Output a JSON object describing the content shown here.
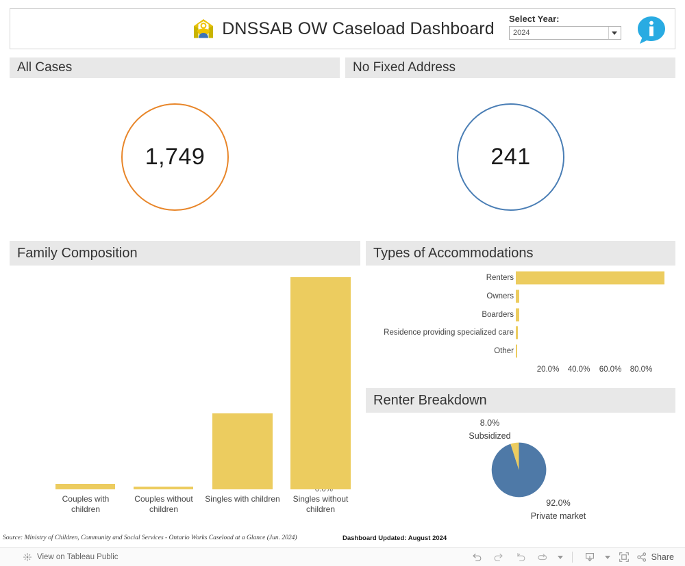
{
  "header": {
    "title": "DNSSAB OW Caseload Dashboard",
    "logo_icon": "dnssab-house-logo",
    "year_filter_label": "Select Year:",
    "year_selected": "2024",
    "year_options": [
      "2024"
    ],
    "info_icon": "info-speech-bubble-icon"
  },
  "panels": {
    "all_cases": {
      "title": "All Cases",
      "value": "1,749",
      "ring_color": "#E8862A"
    },
    "no_fixed_address": {
      "title": "No Fixed Address",
      "value": "241",
      "ring_color": "#4A7EB5"
    },
    "family_composition": {
      "title": "Family Composition"
    },
    "types_of_accommodations": {
      "title": "Types of Accommodations"
    },
    "renter_breakdown": {
      "title": "Renter Breakdown"
    }
  },
  "footer": {
    "source": "Source: Ministry of Children, Community and Social Services - Ontario Works Caseload at a Glance (Jun. 2024)",
    "updated": "Dashboard Updated: August 2024"
  },
  "toolbar": {
    "view_label": "View on Tableau Public",
    "tableau_icon": "tableau-logo-icon",
    "undo_icon": "undo-icon",
    "redo_icon": "redo-icon",
    "revert_icon": "revert-icon",
    "refresh_icon": "refresh-icon",
    "refresh_caret_icon": "chevron-down-icon",
    "download_icon": "download-icon",
    "download_caret_icon": "chevron-down-icon",
    "fullscreen_icon": "fullscreen-icon",
    "share_icon": "share-icon",
    "share_label": "Share"
  },
  "chart_data": [
    {
      "type": "bar",
      "title": "Family Composition",
      "xlabel": "",
      "ylabel": "",
      "categories": [
        "Couples with children",
        "Couples without children",
        "Singles with children",
        "Singles without children"
      ],
      "values": [
        1.7,
        1.0,
        23.0,
        70.0
      ],
      "ylim": [
        0,
        72
      ],
      "yticks": [
        "0.0%",
        "10.0%",
        "20.0%",
        "30.0%",
        "40.0%",
        "50.0%",
        "60.0%",
        "70.0%"
      ],
      "ytick_values": [
        0,
        10,
        20,
        30,
        40,
        50,
        60,
        70
      ],
      "grid": false,
      "color": "#ECCC5F"
    },
    {
      "type": "bar",
      "orientation": "horizontal",
      "title": "Types of Accommodations",
      "categories": [
        "Renters",
        "Owners",
        "Boarders",
        "Residence providing specialized care",
        "Other"
      ],
      "values": [
        95.0,
        2.2,
        2.2,
        1.2,
        0.8
      ],
      "xlim": [
        0,
        96
      ],
      "xticks": [
        "20.0%",
        "40.0%",
        "60.0%",
        "80.0%"
      ],
      "xtick_values": [
        20,
        40,
        60,
        80
      ],
      "grid": false,
      "color": "#ECCC5F"
    },
    {
      "type": "pie",
      "title": "Renter Breakdown",
      "labels": [
        "Subsidized",
        "Private market"
      ],
      "values": [
        8.0,
        92.0
      ],
      "value_labels": [
        "8.0%",
        "92.0%"
      ],
      "colors": [
        "#ECCC5F",
        "#4E79A7"
      ],
      "legend": "outside-labels"
    }
  ]
}
